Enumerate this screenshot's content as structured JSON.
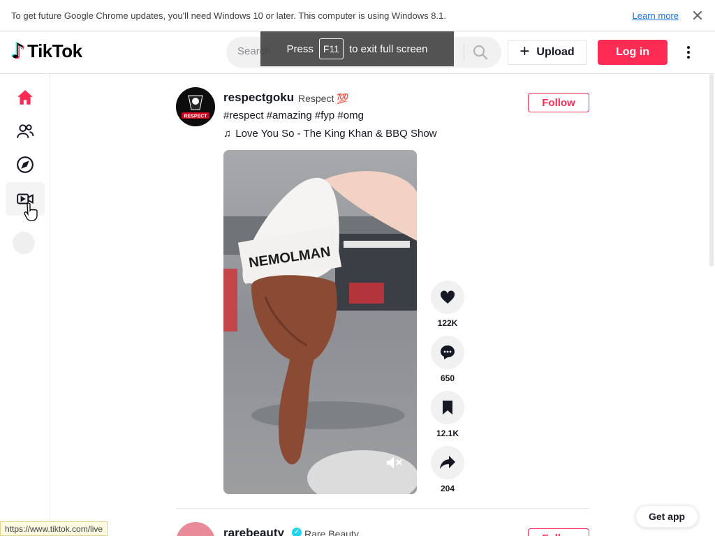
{
  "infobar": {
    "message": "To get future Google Chrome updates, you'll need Windows 10 or later. This computer is using Windows 8.1.",
    "learn_more": "Learn more"
  },
  "fullscreen_toast": {
    "press": "Press",
    "key": "F11",
    "rest": "to exit full screen"
  },
  "header": {
    "logo_text": "TikTok",
    "search_placeholder": "Search",
    "upload_label": "Upload",
    "login_label": "Log in"
  },
  "sidebar": {
    "items": [
      {
        "name": "For You",
        "icon": "home-icon",
        "active": true
      },
      {
        "name": "Following",
        "icon": "users-icon"
      },
      {
        "name": "Explore",
        "icon": "compass-icon"
      },
      {
        "name": "LIVE",
        "icon": "live-video-icon"
      }
    ]
  },
  "post": {
    "author": "respectgoku",
    "nickname": "Respect 💯",
    "avatar_text": "RESPECT",
    "caption": "#respect #amazing #fyp #omg",
    "music": "Love You So - The King Khan & BBQ Show",
    "follow_label": "Follow",
    "video_hat_text": "NEMOLMAN",
    "likes": "122K",
    "comments": "650",
    "saves": "12.1K",
    "shares": "204"
  },
  "next_post": {
    "author": "rarebeauty",
    "nickname": "Rare Beauty",
    "follow_label": "Follow"
  },
  "get_app_label": "Get app",
  "status_url": "https://www.tiktok.com/live",
  "colors": {
    "brand": "#fe2c55",
    "accent_cyan": "#25f4ee"
  }
}
